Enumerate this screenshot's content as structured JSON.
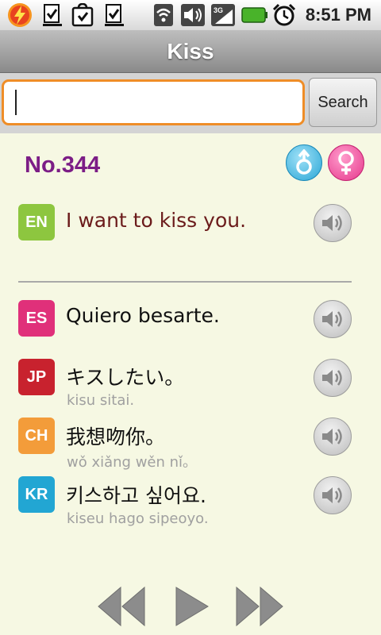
{
  "status_bar": {
    "time": "8:51 PM",
    "icons": [
      "flash-app-icon",
      "download-done-icon",
      "shopping-bag-icon",
      "download-done-icon",
      "wifi-icon",
      "volume-icon",
      "3g-signal-icon",
      "battery-icon",
      "alarm-clock-icon"
    ]
  },
  "header": {
    "title": "Kiss"
  },
  "search": {
    "value": "",
    "button_label": "Search"
  },
  "entry": {
    "number": "No.344"
  },
  "phrases": [
    {
      "lang": "EN",
      "text": "I want to kiss you.",
      "romanization": "",
      "badge_color": "#8dc63f",
      "text_color": "#6b1b1b"
    },
    {
      "lang": "ES",
      "text": "Quiero besarte.",
      "romanization": "",
      "badge_color": "#e0307a",
      "text_color": "#111111"
    },
    {
      "lang": "JP",
      "text": "キスしたい。",
      "romanization": "kisu sitai.",
      "badge_color": "#c8222e",
      "text_color": "#111111"
    },
    {
      "lang": "CH",
      "text": "我想吻你。",
      "romanization": "wǒ xiǎng wěn nǐ。",
      "badge_color": "#f39c3a",
      "text_color": "#111111"
    },
    {
      "lang": "KR",
      "text": "키스하고 싶어요.",
      "romanization": "kiseu hago sipeoyo.",
      "badge_color": "#22a6d3",
      "text_color": "#111111"
    }
  ],
  "colors": {
    "accent_orange": "#ef8d27",
    "number_purple": "#7c1d86",
    "male_blue": "#2aa6d6",
    "female_pink": "#e6388c"
  }
}
